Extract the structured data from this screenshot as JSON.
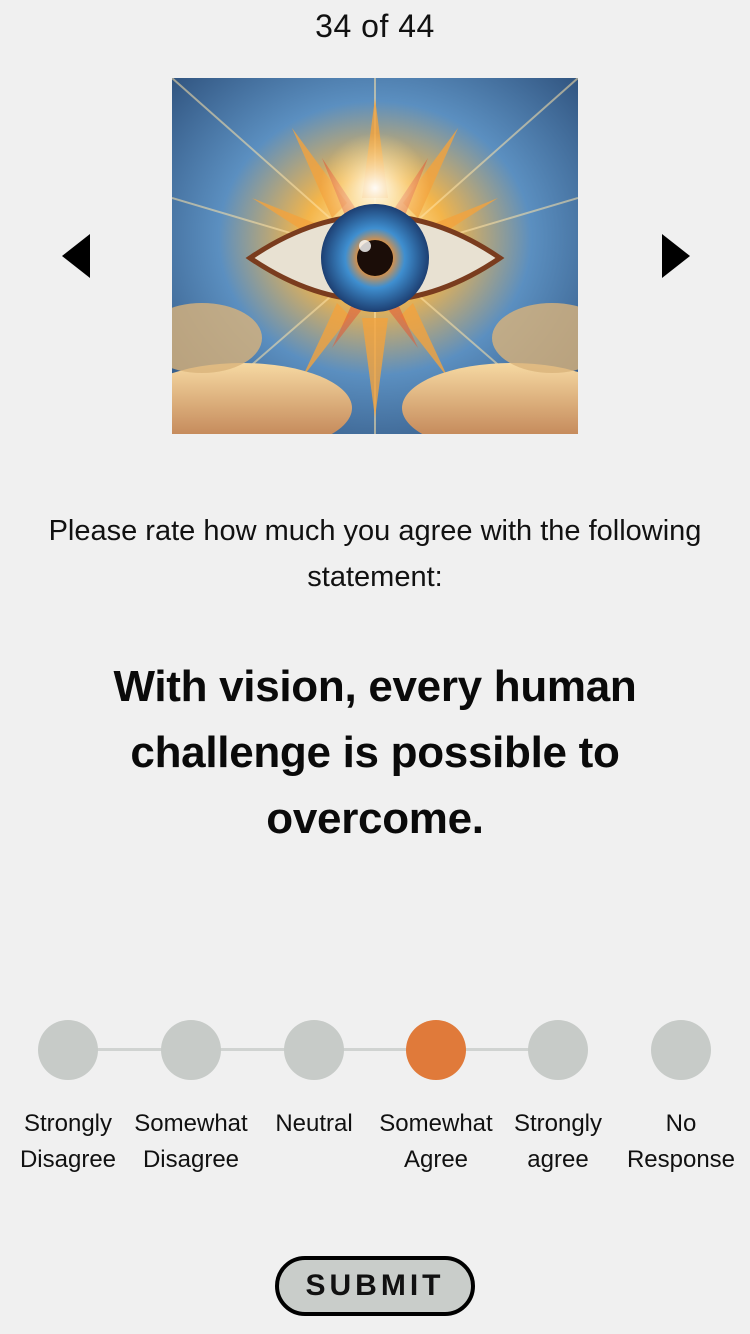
{
  "header": {
    "counter": "34 of 44"
  },
  "navigation": {
    "prev_icon": "triangle-left-icon",
    "next_icon": "triangle-right-icon"
  },
  "artwork": {
    "subject": "eye-artwork-image"
  },
  "question": {
    "prompt": "Please rate how much you agree with the following statement:",
    "statement": "With vision, every human challenge is possible to overcome."
  },
  "scale": {
    "selected_index": 3,
    "selected_color": "#e07a3a",
    "unselected_color": "#c7cbc8",
    "options": [
      {
        "label": "Strongly\nDisagree"
      },
      {
        "label": "Somewhat\nDisagree"
      },
      {
        "label": "Neutral"
      },
      {
        "label": "Somewhat\nAgree"
      },
      {
        "label": "Strongly\nagree"
      },
      {
        "label": "No\nResponse"
      }
    ]
  },
  "actions": {
    "submit_label": "SUBMIT"
  }
}
